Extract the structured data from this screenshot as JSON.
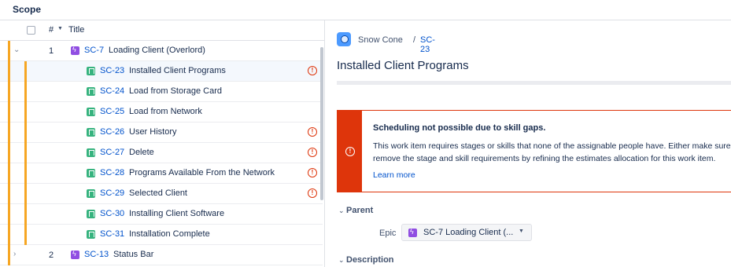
{
  "header": {
    "scope_label": "Scope"
  },
  "columns": {
    "number": "#",
    "sort_icon": "caret-down-icon",
    "title": "Title"
  },
  "rows": [
    {
      "number": "1",
      "key": "SC-7",
      "summary": "Loading Client (Overlord)",
      "type": "epic",
      "expanded": true,
      "warning": false
    },
    {
      "key": "SC-23",
      "summary": "Installed Client Programs",
      "type": "story",
      "warning": true,
      "selected": true
    },
    {
      "key": "SC-24",
      "summary": "Load from Storage Card",
      "type": "story",
      "warning": false
    },
    {
      "key": "SC-25",
      "summary": "Load from Network",
      "type": "story",
      "warning": false
    },
    {
      "key": "SC-26",
      "summary": "User History",
      "type": "story",
      "warning": true
    },
    {
      "key": "SC-27",
      "summary": "Delete",
      "type": "story",
      "warning": true
    },
    {
      "key": "SC-28",
      "summary": "Programs Available From the Network",
      "type": "story",
      "warning": true
    },
    {
      "key": "SC-29",
      "summary": "Selected Client",
      "type": "story",
      "warning": true
    },
    {
      "key": "SC-30",
      "summary": "Installing Client Software",
      "type": "story",
      "warning": false
    },
    {
      "key": "SC-31",
      "summary": "Installation Complete",
      "type": "story",
      "warning": false
    },
    {
      "number": "2",
      "key": "SC-13",
      "summary": "Status Bar",
      "type": "epic",
      "expanded": false,
      "warning": false
    }
  ],
  "detail": {
    "project": "Snow Cone",
    "separator": "/",
    "key": "SC-23",
    "title": "Installed Client Programs",
    "alert": {
      "heading": "Scheduling not possible due to skill gaps.",
      "body_line1": "This work item requires stages or skills that none of the assignable people have. Either make sure",
      "body_line2": "remove the stage and skill requirements by refining the estimates allocation for this work item.",
      "link": "Learn more"
    },
    "parent_section": "Parent",
    "epic_label": "Epic",
    "epic_value": "SC-7 Loading Client (...",
    "description_section": "Description"
  },
  "colors": {
    "epic": "#904ee2",
    "story": "#36b37e",
    "error": "#de350b",
    "link": "#0052cc",
    "rank_bar": "#f6a623"
  }
}
